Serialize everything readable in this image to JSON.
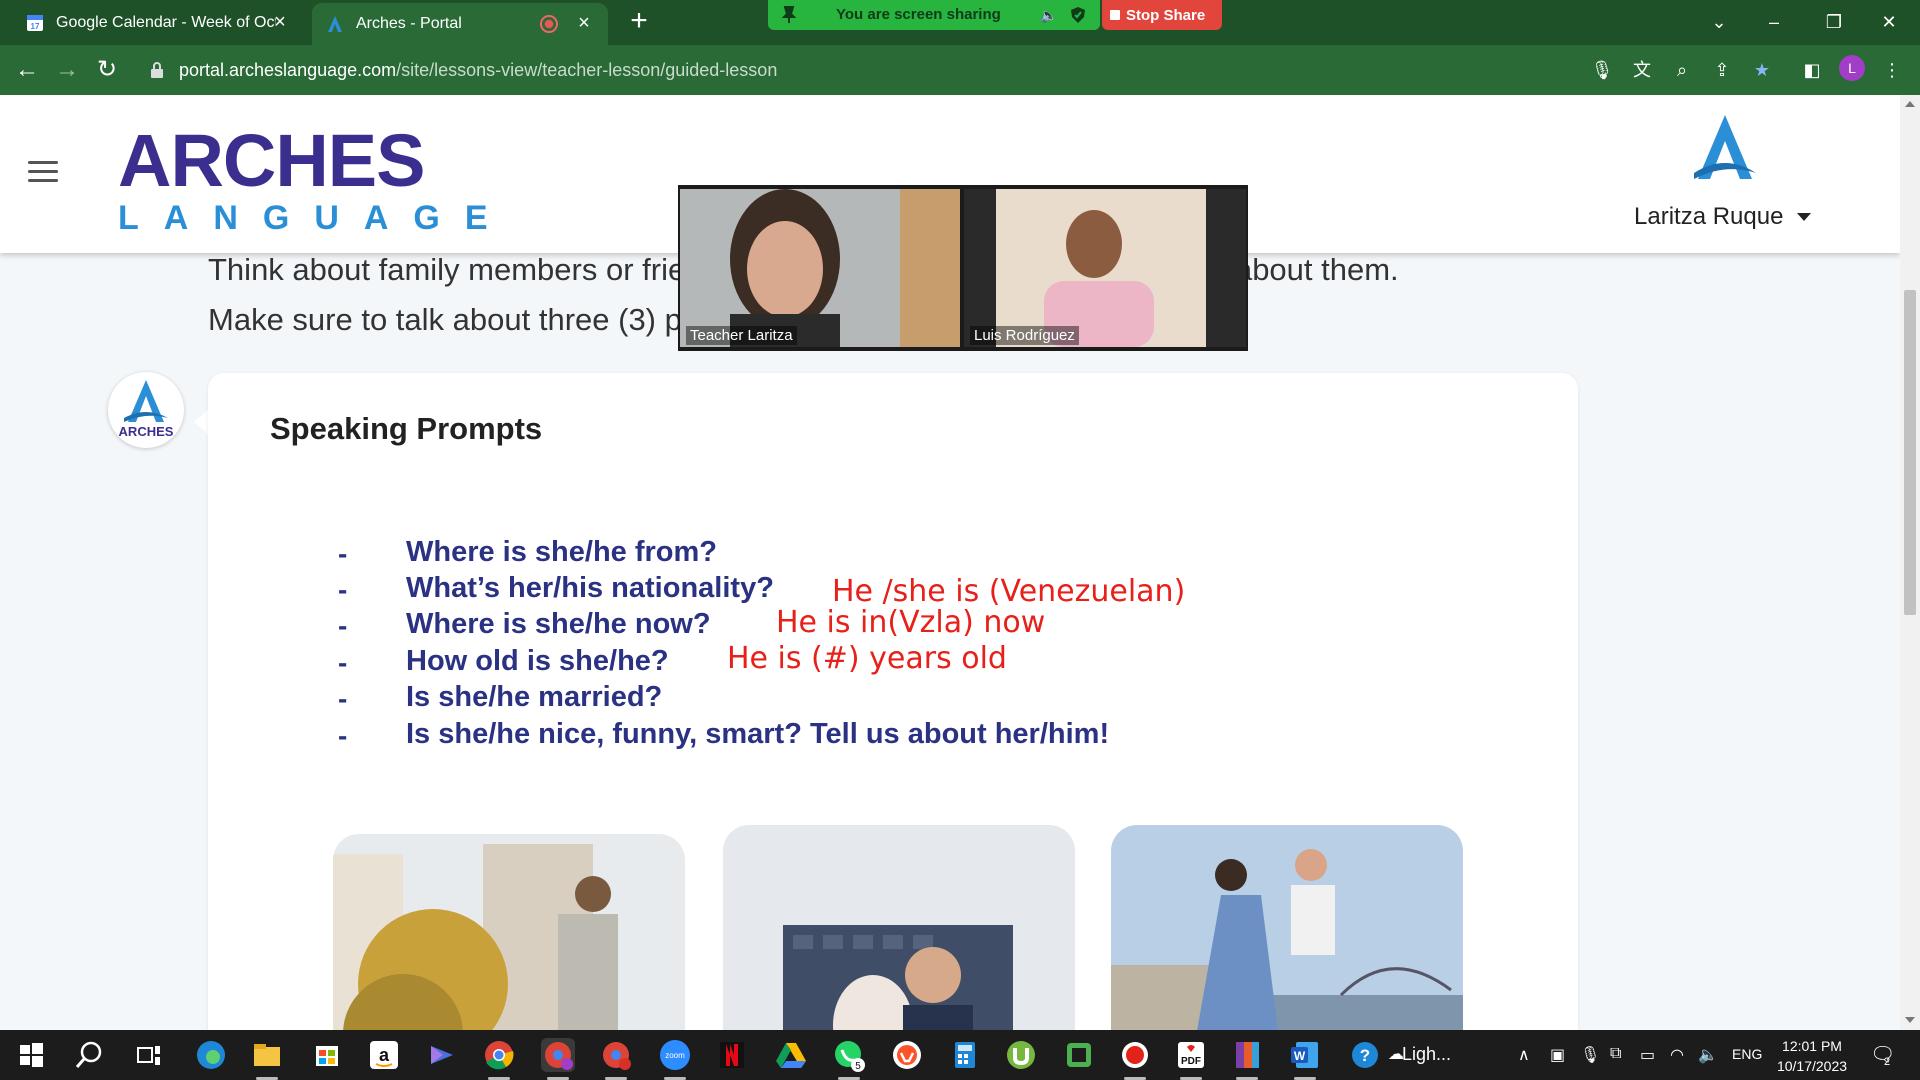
{
  "browser": {
    "tabs": [
      {
        "title": "Google Calendar - Week of Octo",
        "active": false,
        "favicon": "calendar-icon"
      },
      {
        "title": "Arches - Portal",
        "active": true,
        "favicon": "arches-a-icon"
      }
    ],
    "new_tab_label": "+",
    "url_domain": "portal.archeslanguage.com",
    "url_path": "/site/lessons-view/teacher-lesson/guided-lesson",
    "profile_initial": "L"
  },
  "screen_share": {
    "status_text": "You are screen sharing",
    "stop_label": "Stop Share"
  },
  "header": {
    "logo_main": "ARCHES",
    "logo_sub": "LANGUAGE",
    "user_name": "Laritza Ruque"
  },
  "video": {
    "participants": [
      {
        "name": "Teacher Laritza"
      },
      {
        "name": "Luis Rodríguez"
      }
    ]
  },
  "lesson": {
    "instructions_line1": "Think about family members or friends and answer the following questions about them.",
    "instructions_line2": "Make sure to talk about three (3) people at least.",
    "card_title": "Speaking Prompts",
    "avatar_logo_text": "ARCHES",
    "prompts": [
      {
        "dash": "-",
        "text": "Where is she/he from?"
      },
      {
        "dash": "-",
        "text": "What’s her/his nationality?"
      },
      {
        "dash": "-",
        "text": "Where is she/he now?"
      },
      {
        "dash": "-",
        "text": "How old is she/he?"
      },
      {
        "dash": "-",
        "text": "Is she/he married?"
      },
      {
        "dash": "-",
        "text": "Is she/he nice, funny, smart? Tell us about her/him!"
      }
    ],
    "answers": [
      "He /she is (Venezuelan)",
      "He is in(Vzla) now",
      "He is (#) years old"
    ]
  },
  "taskbar": {
    "weather_text": "Ligh...",
    "language": "ENG",
    "time": "12:01 PM",
    "date": "10/17/2023",
    "whatsapp_badge": "5",
    "notification_count": "2",
    "icons": [
      "windows-start-icon",
      "search-icon",
      "task-view-icon",
      "edge-icon",
      "file-explorer-icon",
      "microsoft-store-icon",
      "amazon-icon",
      "power-automate-icon",
      "chrome-icon",
      "chrome-profile-icon",
      "chrome-profile-2-icon",
      "zoom-icon",
      "netflix-icon",
      "google-drive-icon",
      "whatsapp-icon",
      "brave-icon",
      "calculator-icon",
      "utorrent-icon",
      "camtasia-icon",
      "screen-recorder-icon",
      "ilovepdf-icon",
      "winrar-icon",
      "word-icon",
      "help-icon"
    ],
    "zoom_label": "zoom"
  },
  "colors": {
    "chrome_tabbar": "#1f5129",
    "chrome_toolbar": "#2a6a36",
    "share_green": "#27b540",
    "stop_red": "#e2453c",
    "brand_navy": "#3a2f8f",
    "brand_blue": "#2a8fd6",
    "prompt_navy": "#2b3183",
    "answer_red": "#e8201a"
  }
}
